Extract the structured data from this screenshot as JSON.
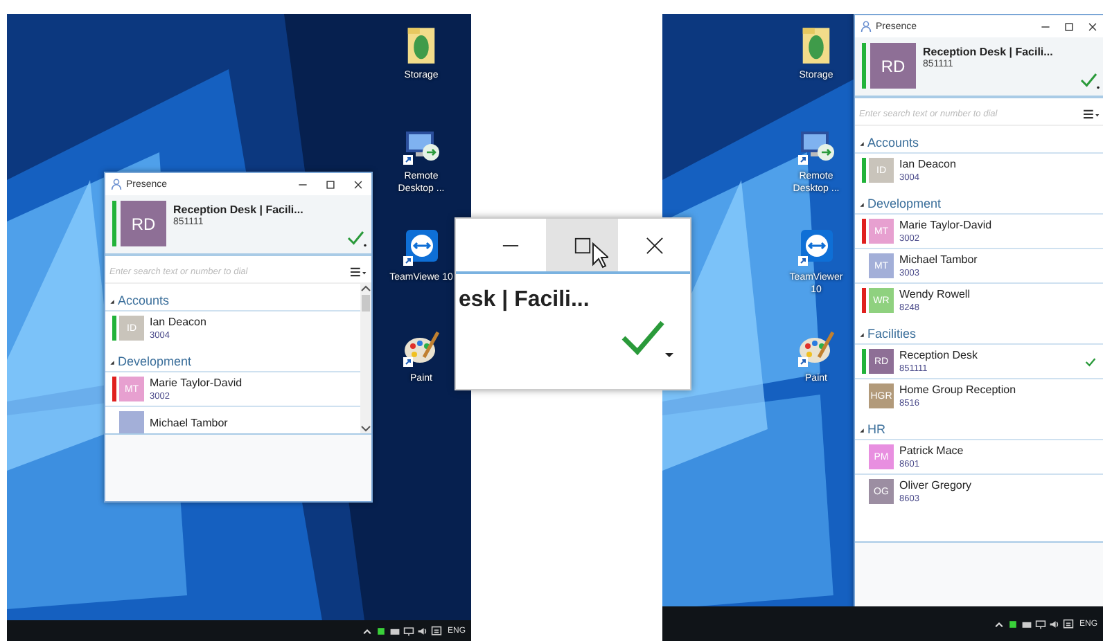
{
  "screens": [
    {
      "desktop_icons": [
        {
          "label": "Storage",
          "kind": "folder"
        },
        {
          "label": "Remote Desktop ...",
          "kind": "remote"
        },
        {
          "label": "TeamViewe 10",
          "kind": "teamviewer"
        },
        {
          "label": "Paint",
          "kind": "paint"
        }
      ],
      "window": {
        "title": "Presence",
        "scrollbar": true,
        "me": {
          "avatar": {
            "initials": "RD",
            "color": "#8e6f96"
          },
          "name": "Reception Desk | Facili...",
          "number": "851111",
          "color": "#22b33a",
          "checked": true
        },
        "search": {
          "placeholder": "Enter search text or number to dial"
        },
        "groups": [
          {
            "name": "Accounts",
            "expanded": true,
            "contacts": [
              {
                "avatar": {
                  "initials": "ID",
                  "color": "#c9c4bb"
                },
                "name": "Ian Deacon",
                "number": "3004",
                "color": "#22b33a",
                "checked": false
              }
            ]
          },
          {
            "name": "Development",
            "expanded": true,
            "contacts": [
              {
                "avatar": {
                  "initials": "MT",
                  "color": "#e7a0d0"
                },
                "name": "Marie Taylor-David",
                "number": "3002",
                "color": "#e0201e",
                "checked": false
              },
              {
                "avatar": {
                  "color": "#a3afd8"
                },
                "name": "Michael Tambor",
                "checked": false
              }
            ]
          }
        ]
      },
      "taskbar": {
        "language": "ENG"
      }
    },
    {
      "desktop_icons": [
        {
          "label": "Storage",
          "kind": "folder"
        },
        {
          "label": "Remote Desktop ...",
          "kind": "remote"
        },
        {
          "label": "TeamViewer 10",
          "kind": "teamviewer"
        },
        {
          "label": "Paint",
          "kind": "paint"
        }
      ],
      "window": {
        "title": "Presence",
        "scrollbar": false,
        "me": {
          "avatar": {
            "initials": "RD",
            "color": "#8e6f96"
          },
          "name": "Reception Desk | Facili...",
          "number": "851111",
          "color": "#22b33a",
          "checked": true
        },
        "search": {
          "placeholder": "Enter search text or number to dial"
        },
        "groups": [
          {
            "name": "Accounts",
            "expanded": true,
            "contacts": [
              {
                "avatar": {
                  "initials": "ID",
                  "color": "#c9c4bb"
                },
                "name": "Ian Deacon",
                "number": "3004",
                "color": "#22b33a",
                "checked": false
              }
            ]
          },
          {
            "name": "Development",
            "expanded": true,
            "contacts": [
              {
                "avatar": {
                  "initials": "MT",
                  "color": "#e7a0d0"
                },
                "name": "Marie Taylor-David",
                "number": "3002",
                "color": "#e0201e",
                "checked": false
              },
              {
                "avatar": {
                  "initials": "MT",
                  "color": "#a3afd8"
                },
                "name": "Michael Tambor",
                "number": "3003",
                "checked": false
              },
              {
                "avatar": {
                  "initials": "WR",
                  "color": "#8fd17f"
                },
                "name": "Wendy Rowell",
                "number": "8248",
                "color": "#e0201e",
                "checked": false
              }
            ]
          },
          {
            "name": "Facilities",
            "expanded": true,
            "contacts": [
              {
                "avatar": {
                  "initials": "RD",
                  "color": "#8e6f96"
                },
                "name": "Reception Desk",
                "number": "851111",
                "color": "#22b33a",
                "checked": true
              },
              {
                "avatar": {
                  "initials": "HGR",
                  "color": "#b29a7a"
                },
                "name": "Home Group Reception",
                "number": "8516",
                "checked": false
              }
            ]
          },
          {
            "name": "HR",
            "expanded": true,
            "contacts": [
              {
                "avatar": {
                  "initials": "PM",
                  "color": "#e88fe0"
                },
                "name": "Patrick Mace",
                "number": "8601",
                "checked": false
              },
              {
                "avatar": {
                  "initials": "OG",
                  "color": "#9c8ea2"
                },
                "name": "Oliver Gregory",
                "number": "8603",
                "checked": false
              }
            ]
          }
        ]
      },
      "taskbar": {
        "language": "ENG"
      }
    }
  ],
  "callout": {
    "title_fragment": "esk | Facili...",
    "checked": true,
    "buttons": [
      {
        "kind": "minimize",
        "hovered": false
      },
      {
        "kind": "maximize",
        "hovered": true
      },
      {
        "kind": "close",
        "hovered": false
      }
    ]
  }
}
